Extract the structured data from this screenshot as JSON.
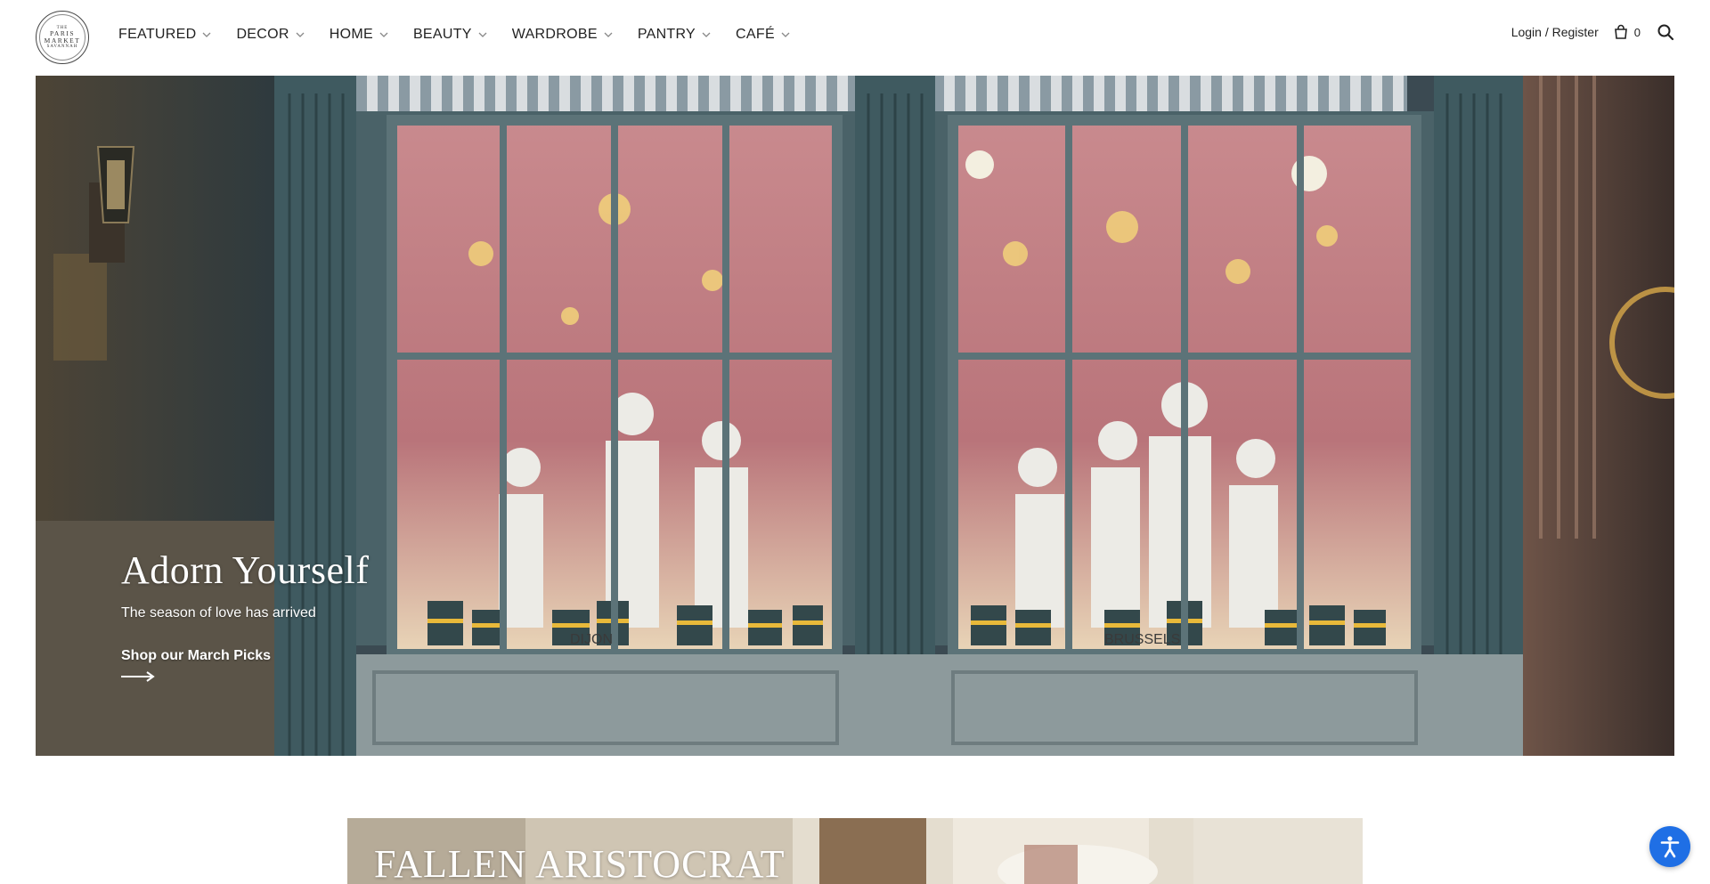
{
  "logo": {
    "line1": "THE",
    "line2": "PARIS",
    "line3": "MARKET",
    "line4": "SAVANNAH"
  },
  "nav": {
    "items": [
      {
        "label": "FEATURED"
      },
      {
        "label": "DECOR"
      },
      {
        "label": "HOME"
      },
      {
        "label": "BEAUTY"
      },
      {
        "label": "WARDROBE"
      },
      {
        "label": "PANTRY"
      },
      {
        "label": "CAFÉ"
      }
    ]
  },
  "header": {
    "login_label": "Login / Register",
    "cart_count": "0",
    "icons": [
      "chevron-down-icon",
      "cart-icon",
      "search-icon"
    ]
  },
  "hero": {
    "title": "Adorn Yourself",
    "subtitle": "The season of love has arrived",
    "link_label": "Shop our March Picks",
    "window_sign_left": "DIJON",
    "window_sign_right": "BRUSSELS"
  },
  "banner2": {
    "title": "FALLEN ARISTOCRAT"
  },
  "accessibility": {
    "icon": "accessibility-icon",
    "color": "#1f6fe5"
  }
}
